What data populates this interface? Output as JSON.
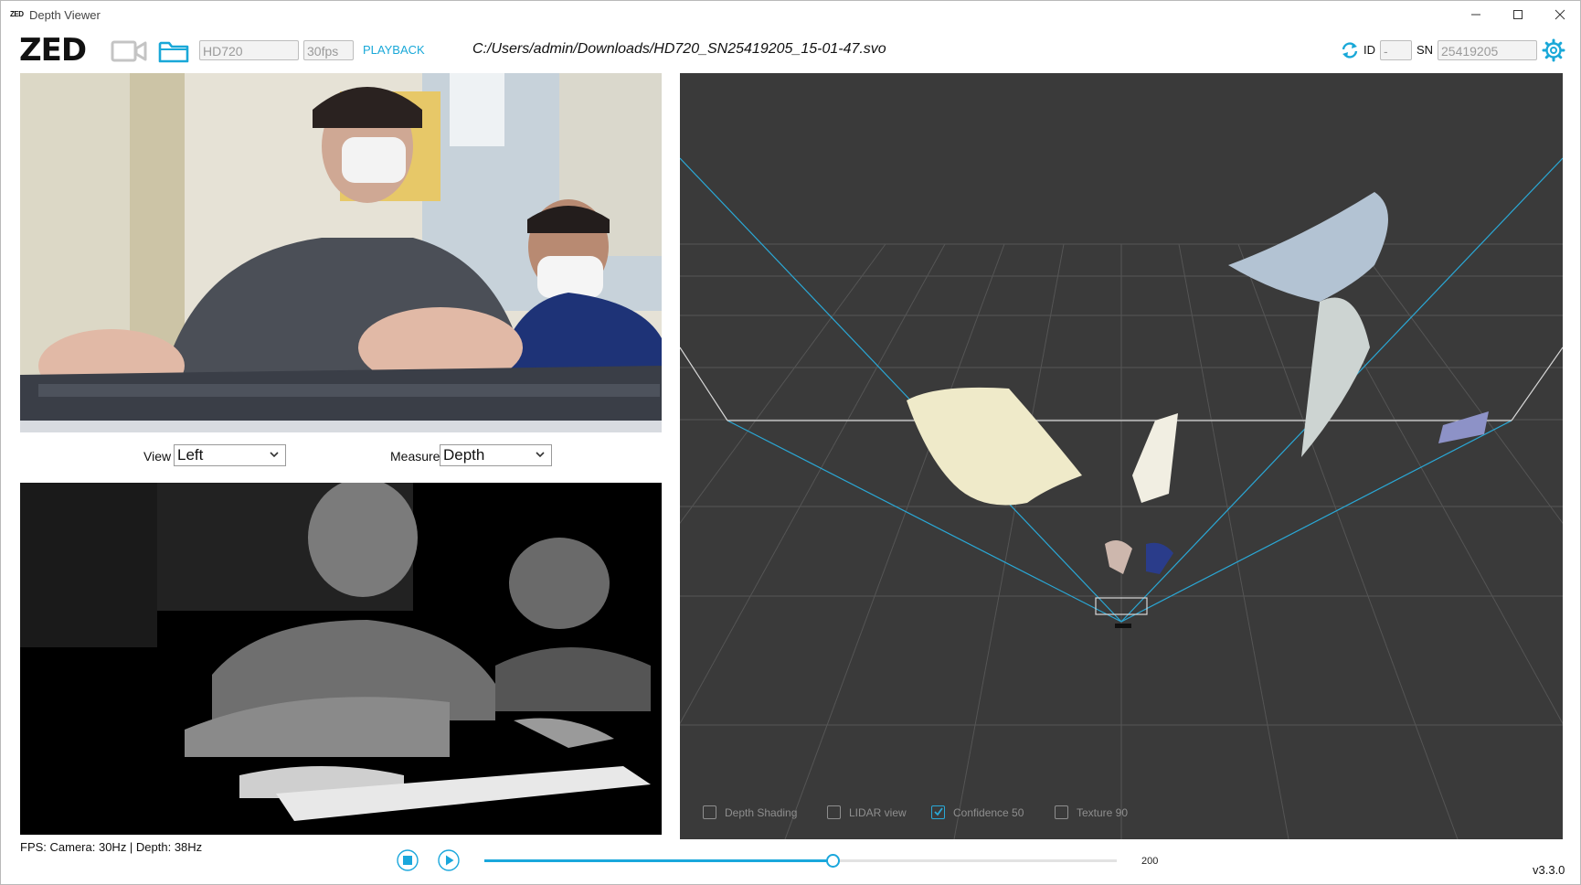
{
  "window": {
    "app_icon": "ZED",
    "title": "Depth Viewer"
  },
  "toolbar": {
    "logo": "ZED",
    "camera_icon": "video-camera-icon",
    "folder_icon": "folder-icon",
    "resolution": "HD720",
    "fps": "30fps",
    "mode": "PLAYBACK",
    "file_path": "C:/Users/admin/Downloads/HD720_SN25419205_15-01-47.svo",
    "id_label": "ID",
    "id_value": "-",
    "sn_label": "SN",
    "sn_value": "25419205",
    "accent_color": "#19a8d8"
  },
  "controls": {
    "view_label": "View",
    "view_value": "Left",
    "measure_label": "Measure",
    "measure_value": "Depth"
  },
  "status": {
    "fps_text": "FPS: Camera: 30Hz | Depth: 38Hz"
  },
  "viewer3d": {
    "options": [
      {
        "label": "Depth Shading",
        "checked": false
      },
      {
        "label": "LIDAR view",
        "checked": false
      },
      {
        "label": "Confidence 50",
        "checked": true
      },
      {
        "label": "Texture 90",
        "checked": false
      }
    ]
  },
  "playback": {
    "progress": 0.55,
    "frame_count": "200"
  },
  "version": "v3.3.0"
}
